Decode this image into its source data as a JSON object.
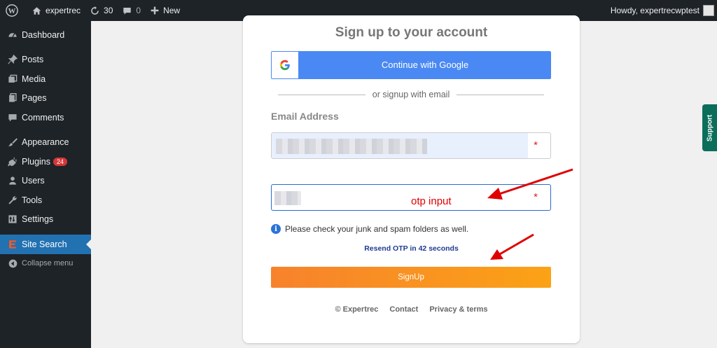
{
  "admin_bar": {
    "site_name": "expertrec",
    "updates_count": "30",
    "comments_count": "0",
    "new_label": "New",
    "howdy": "Howdy, expertrecwptest"
  },
  "sidebar": {
    "items": [
      {
        "label": "Dashboard",
        "icon": "dashboard-icon"
      },
      {
        "label": "Posts",
        "icon": "pin-icon"
      },
      {
        "label": "Media",
        "icon": "media-icon"
      },
      {
        "label": "Pages",
        "icon": "pages-icon"
      },
      {
        "label": "Comments",
        "icon": "comment-icon"
      },
      {
        "label": "Appearance",
        "icon": "brush-icon"
      },
      {
        "label": "Plugins",
        "icon": "plug-icon",
        "badge": "24"
      },
      {
        "label": "Users",
        "icon": "user-icon"
      },
      {
        "label": "Tools",
        "icon": "wrench-icon"
      },
      {
        "label": "Settings",
        "icon": "settings-icon"
      },
      {
        "label": "Site Search",
        "icon": "expertrec-logo-icon"
      }
    ],
    "collapse_label": "Collapse menu"
  },
  "signup": {
    "title": "Sign up to your account",
    "google_label": "Continue with Google",
    "divider_text": "or signup with email",
    "email_label": "Email Address",
    "required_marker": "*",
    "otp_annotation": "otp input",
    "info_text": "Please check your junk and spam folders as well.",
    "resend_text": "Resend OTP in 42 seconds",
    "signup_label": "SignUp",
    "footer": {
      "copyright": "© Expertrec",
      "contact": "Contact",
      "privacy": "Privacy & terms"
    }
  },
  "support_tab": "Support",
  "colors": {
    "admin_bg": "#1d2327",
    "active_menu": "#2271b1",
    "google_blue": "#4a89f3",
    "signup_orange": "#f7822c",
    "annotation_red": "#e00000",
    "support_green": "#0a6e5a"
  }
}
